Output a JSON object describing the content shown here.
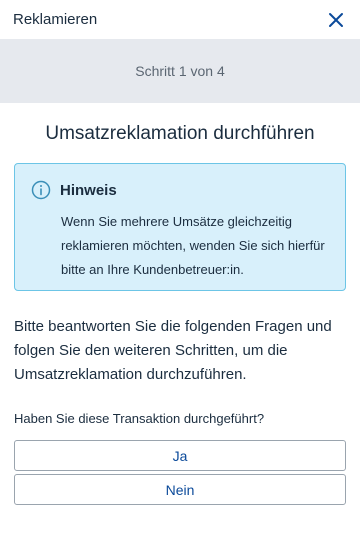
{
  "header": {
    "title": "Reklamieren"
  },
  "stepper": {
    "label": "Schritt 1 von 4"
  },
  "main": {
    "title": "Umsatzreklamation durchführen"
  },
  "notice": {
    "title": "Hinweis",
    "text": "Wenn Sie mehrere Umsätze gleichzeitig reklamieren möchten, wenden Sie sich hierfür bitte an Ihre Kundenbetreuer:in."
  },
  "intro": "Bitte beantworten Sie die folgenden Fragen und folgen Sie den weiteren Schritten, um die Umsatzreklamation durchzuführen.",
  "question": {
    "label": "Haben Sie diese Transaktion durchgeführt?",
    "yes_label": "Ja",
    "no_label": "Nein"
  },
  "colors": {
    "accent": "#0b4a9a",
    "info_bg": "#d8f0fb",
    "info_border": "#6cc5e6",
    "step_bg": "#e6e9ee"
  }
}
